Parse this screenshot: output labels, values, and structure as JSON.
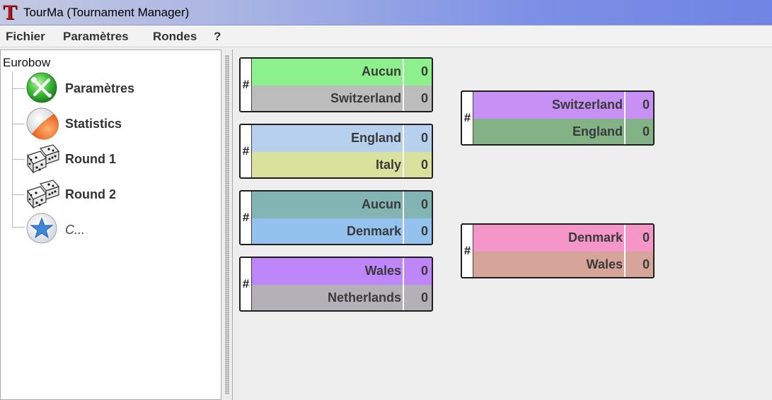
{
  "window": {
    "title": "TourMa (Tournament Manager)",
    "app_icon": "T"
  },
  "menu": {
    "items": [
      {
        "label": "Fichier"
      },
      {
        "label": "Paramètres"
      },
      {
        "label": "Rondes"
      },
      {
        "label": "?"
      }
    ]
  },
  "tree": {
    "root": "Eurobow",
    "nodes": [
      {
        "label": "Paramètres",
        "icon": "wrench-screwdriver-icon"
      },
      {
        "label": "Statistics",
        "icon": "pie-chart-icon"
      },
      {
        "label": "Round 1",
        "icon": "dice-icon"
      },
      {
        "label": "Round 2",
        "icon": "dice-icon"
      },
      {
        "label": "C...",
        "icon": "star-icon"
      }
    ]
  },
  "colors": {
    "green": "#8cf08c",
    "gray": "#bcbcbc",
    "light_blue": "#b6d0ee",
    "khaki": "#d8e29c",
    "teal": "#82b4b4",
    "sky_blue": "#94c2ee",
    "purple": "#be86f8",
    "mauve_gray": "#b4b0b8",
    "violet": "#c690f4",
    "sage": "#82b286",
    "pink": "#f496c8",
    "rose_brown": "#d6a498"
  },
  "bracket": {
    "round1": [
      {
        "hash": "#",
        "teams": [
          {
            "name": "Aucun",
            "score": "0",
            "color": "#8cf08c"
          },
          {
            "name": "Switzerland",
            "score": "0",
            "color": "#bcbcbc"
          }
        ]
      },
      {
        "hash": "#",
        "teams": [
          {
            "name": "England",
            "score": "0",
            "color": "#b6d0ee"
          },
          {
            "name": "Italy",
            "score": "0",
            "color": "#d8e29c"
          }
        ]
      },
      {
        "hash": "#",
        "teams": [
          {
            "name": "Aucun",
            "score": "0",
            "color": "#82b4b4"
          },
          {
            "name": "Denmark",
            "score": "0",
            "color": "#94c2ee"
          }
        ]
      },
      {
        "hash": "#",
        "teams": [
          {
            "name": "Wales",
            "score": "0",
            "color": "#be86f8"
          },
          {
            "name": "Netherlands",
            "score": "0",
            "color": "#b4b0b8"
          }
        ]
      }
    ],
    "round2": [
      {
        "hash": "#",
        "teams": [
          {
            "name": "Switzerland",
            "score": "0",
            "color": "#c690f4"
          },
          {
            "name": "England",
            "score": "0",
            "color": "#82b286"
          }
        ]
      },
      {
        "hash": "#",
        "teams": [
          {
            "name": "Denmark",
            "score": "0",
            "color": "#f496c8"
          },
          {
            "name": "Wales",
            "score": "0",
            "color": "#d6a498"
          }
        ]
      }
    ]
  }
}
